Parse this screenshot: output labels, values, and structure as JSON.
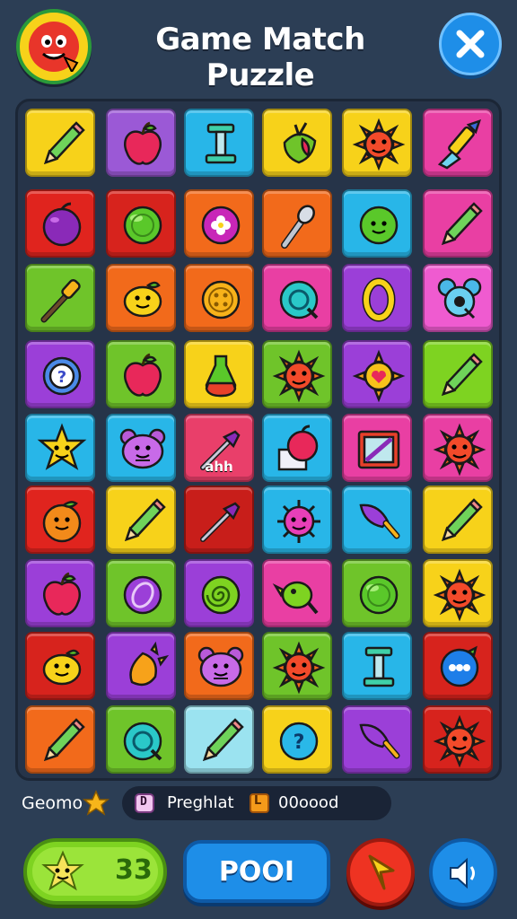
{
  "header": {
    "title": "Game Match Puzzle",
    "logo_icon": "tomato-face-icon",
    "close_icon": "close-icon"
  },
  "board": {
    "rows": [
      [
        {
          "color": "#f7d21a",
          "icon": "pencil-icon"
        },
        {
          "color": "#9b59d6",
          "icon": "apple-icon"
        },
        {
          "color": "#28b6e8",
          "icon": "trophy-pedestal-icon"
        },
        {
          "color": "#f7d21a",
          "icon": "fruit-leaf-icon"
        },
        {
          "color": "#f7d21a",
          "icon": "sun-face-icon"
        },
        {
          "color": "#e93fa3",
          "icon": "paintbrush-icon"
        }
      ],
      [
        {
          "color": "#e0241e",
          "icon": "plum-icon"
        },
        {
          "color": "#d7231d",
          "icon": "green-ball-icon"
        },
        {
          "color": "#f26a1b",
          "icon": "flower-orb-icon"
        },
        {
          "color": "#f26a1b",
          "icon": "torch-icon"
        },
        {
          "color": "#28b6e8",
          "icon": "green-face-ball-icon"
        },
        {
          "color": "#e93fa3",
          "icon": "pencil-icon"
        }
      ],
      [
        {
          "color": "#6fc42a",
          "icon": "wand-icon"
        },
        {
          "color": "#f26a1b",
          "icon": "lemon-face-icon"
        },
        {
          "color": "#f26a1b",
          "icon": "button-coin-icon"
        },
        {
          "color": "#e93fa3",
          "icon": "teal-orb-icon"
        },
        {
          "color": "#9b3fd8",
          "icon": "ring-icon"
        },
        {
          "color": "#ef5bd0",
          "icon": "mouse-face-icon"
        }
      ],
      [
        {
          "color": "#9b3fd8",
          "icon": "gear-question-icon"
        },
        {
          "color": "#6fc42a",
          "icon": "apple-icon"
        },
        {
          "color": "#f7d21a",
          "icon": "potion-icon"
        },
        {
          "color": "#6fc42a",
          "icon": "sun-face-icon"
        },
        {
          "color": "#9b3fd8",
          "icon": "sun-heart-icon"
        },
        {
          "color": "#7ed321",
          "icon": "pencil-icon"
        }
      ],
      [
        {
          "color": "#28b6e8",
          "icon": "star-face-icon"
        },
        {
          "color": "#28b6e8",
          "icon": "bear-face-icon"
        },
        {
          "color": "#e93f6a",
          "icon": "brush-icon",
          "label": "ahh"
        },
        {
          "color": "#28b6e8",
          "icon": "apple-box-icon"
        },
        {
          "color": "#e93fa3",
          "icon": "picture-frame-icon"
        },
        {
          "color": "#e93fa3",
          "icon": "sun-face-icon"
        }
      ],
      [
        {
          "color": "#e0241e",
          "icon": "orange-face-icon"
        },
        {
          "color": "#f7d21a",
          "icon": "pencil-icon"
        },
        {
          "color": "#c81e1a",
          "icon": "brush-icon"
        },
        {
          "color": "#28b6e8",
          "icon": "virus-face-icon"
        },
        {
          "color": "#28b6e8",
          "icon": "feather-brush-icon"
        },
        {
          "color": "#f7d21a",
          "icon": "pencil-icon"
        }
      ],
      [
        {
          "color": "#9b3fd8",
          "icon": "apple-icon"
        },
        {
          "color": "#6fc42a",
          "icon": "purple-orb-icon"
        },
        {
          "color": "#9b3fd8",
          "icon": "spiral-orb-icon"
        },
        {
          "color": "#e93fa3",
          "icon": "bird-icon"
        },
        {
          "color": "#6fc42a",
          "icon": "green-ball-icon"
        },
        {
          "color": "#f7d21a",
          "icon": "sun-face-icon"
        }
      ],
      [
        {
          "color": "#d7231d",
          "icon": "lemon-face-icon"
        },
        {
          "color": "#9b3fd8",
          "icon": "mango-icon"
        },
        {
          "color": "#f26a1b",
          "icon": "bear-face-icon"
        },
        {
          "color": "#6fc42a",
          "icon": "sun-face-icon"
        },
        {
          "color": "#28b6e8",
          "icon": "trophy-pedestal-icon"
        },
        {
          "color": "#d7231d",
          "icon": "blue-face-ball-icon"
        }
      ],
      [
        {
          "color": "#f26a1b",
          "icon": "pencil-icon"
        },
        {
          "color": "#6fc42a",
          "icon": "teal-orb-icon"
        },
        {
          "color": "#9be3f0",
          "icon": "pencil-icon"
        },
        {
          "color": "#f7d21a",
          "icon": "question-orb-icon"
        },
        {
          "color": "#9b3fd8",
          "icon": "feather-brush-icon"
        },
        {
          "color": "#d7231d",
          "icon": "sun-face-icon"
        }
      ]
    ]
  },
  "status": {
    "left_label": "Geomo",
    "star_icon": "star-icon",
    "pill_a_icon_char": "D",
    "pill_a_text": "Preghlat",
    "pill_b_icon_char": "L",
    "pill_b_text": "00οοοd"
  },
  "controls": {
    "green_button_label": "33",
    "green_button_icon": "puzzle-star-icon",
    "play_button_label": "POOI",
    "red_button_icon": "back-arrow-icon",
    "sound_button_icon": "speaker-icon"
  }
}
